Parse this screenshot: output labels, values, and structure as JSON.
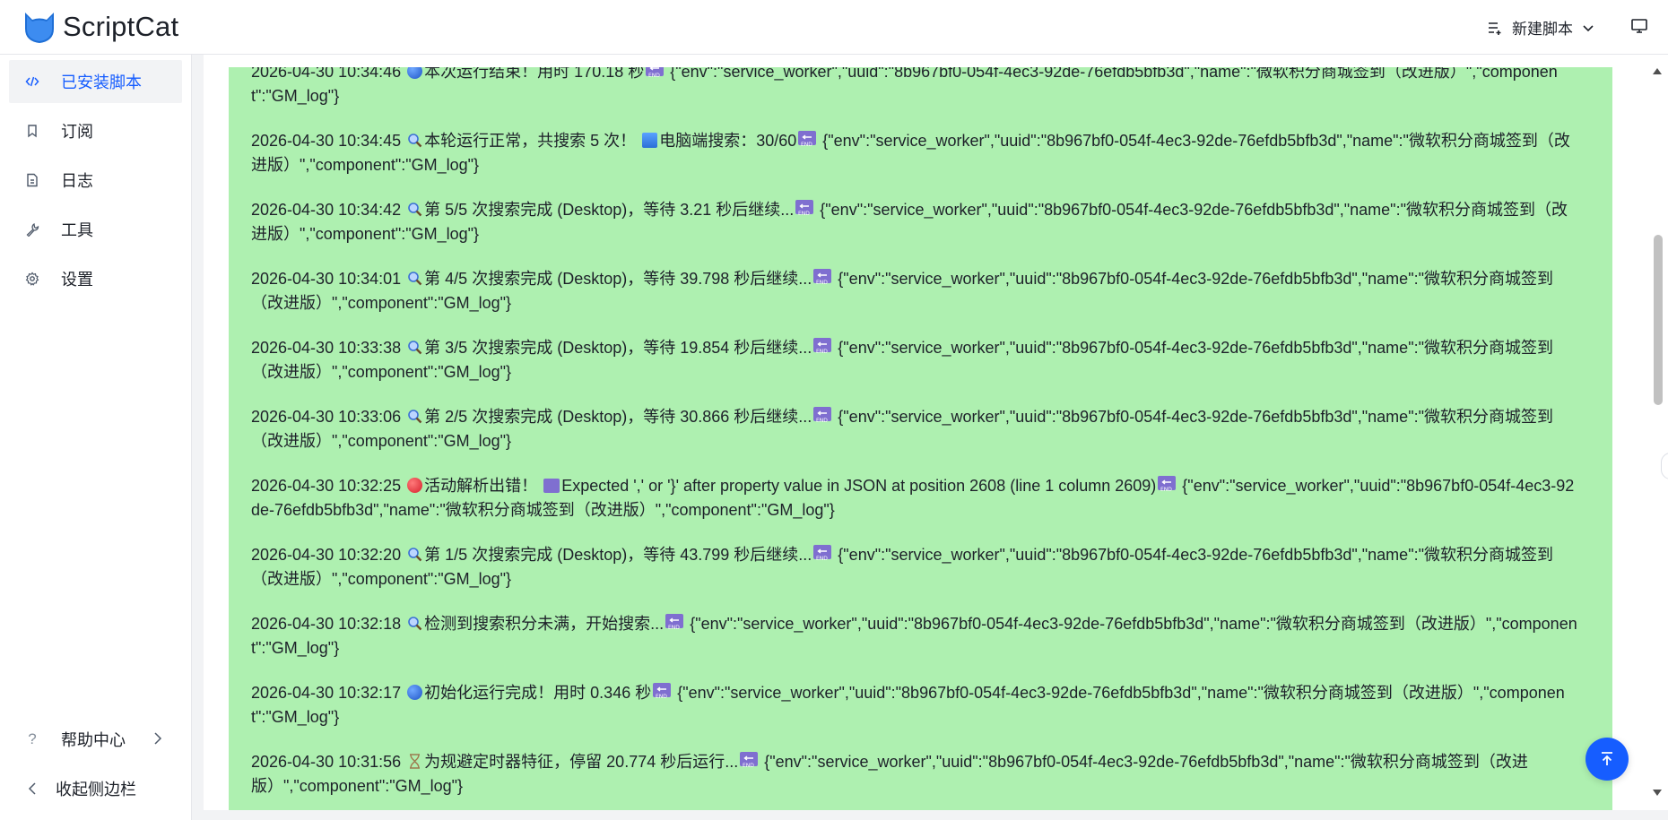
{
  "header": {
    "app_title": "ScriptCat",
    "new_script_label": "新建脚本"
  },
  "sidebar": {
    "items": [
      {
        "label": "已安装脚本",
        "active": true,
        "icon": "code-icon"
      },
      {
        "label": "订阅",
        "active": false,
        "icon": "bookmark-icon"
      },
      {
        "label": "日志",
        "active": false,
        "icon": "document-icon"
      },
      {
        "label": "工具",
        "active": false,
        "icon": "wrench-icon"
      },
      {
        "label": "设置",
        "active": false,
        "icon": "gear-icon"
      }
    ],
    "help_label": "帮助中心",
    "collapse_label": "收起侧边栏"
  },
  "logs": [
    {
      "time": "2026-04-30 10:34:46",
      "icon": "globe-icon",
      "message": "本次运行结束！用时 170.18 秒",
      "meta": " {\"env\":\"service_worker\",\"uuid\":\"8b967bf0-054f-4ec3-92de-76efdb5bfb3d\",\"name\":\"微软积分商城签到（改进版）\",\"component\":\"GM_log\"}"
    },
    {
      "time": "2026-04-30 10:34:45",
      "icon": "magnifier-icon",
      "message": "本轮运行正常，共搜索 5 次！",
      "extra_icon": "computer-icon",
      "extra": "电脑端搜索：30/60",
      "meta": " {\"env\":\"service_worker\",\"uuid\":\"8b967bf0-054f-4ec3-92de-76efdb5bfb3d\",\"name\":\"微软积分商城签到（改进版）\",\"component\":\"GM_log\"}"
    },
    {
      "time": "2026-04-30 10:34:42",
      "icon": "magnifier-icon",
      "message": "第 5/5 次搜索完成 (Desktop)，等待 3.21 秒后继续...",
      "meta": " {\"env\":\"service_worker\",\"uuid\":\"8b967bf0-054f-4ec3-92de-76efdb5bfb3d\",\"name\":\"微软积分商城签到（改进版）\",\"component\":\"GM_log\"}"
    },
    {
      "time": "2026-04-30 10:34:01",
      "icon": "magnifier-icon",
      "message": "第 4/5 次搜索完成 (Desktop)，等待 39.798 秒后继续...",
      "meta": " {\"env\":\"service_worker\",\"uuid\":\"8b967bf0-054f-4ec3-92de-76efdb5bfb3d\",\"name\":\"微软积分商城签到（改进版）\",\"component\":\"GM_log\"}"
    },
    {
      "time": "2026-04-30 10:33:38",
      "icon": "magnifier-icon",
      "message": "第 3/5 次搜索完成 (Desktop)，等待 19.854 秒后继续...",
      "meta": " {\"env\":\"service_worker\",\"uuid\":\"8b967bf0-054f-4ec3-92de-76efdb5bfb3d\",\"name\":\"微软积分商城签到（改进版）\",\"component\":\"GM_log\"}"
    },
    {
      "time": "2026-04-30 10:33:06",
      "icon": "magnifier-icon",
      "message": "第 2/5 次搜索完成 (Desktop)，等待 30.866 秒后继续...",
      "meta": " {\"env\":\"service_worker\",\"uuid\":\"8b967bf0-054f-4ec3-92de-76efdb5bfb3d\",\"name\":\"微软积分商城签到（改进版）\",\"component\":\"GM_log\"}"
    },
    {
      "time": "2026-04-30 10:32:25",
      "icon": "red-circle-icon",
      "message": "活动解析出错！",
      "extra_icon": "arrows-icon",
      "extra": "Expected ',' or '}' after property value in JSON at position 2608 (line 1 column 2609)",
      "meta": " {\"env\":\"service_worker\",\"uuid\":\"8b967bf0-054f-4ec3-92de-76efdb5bfb3d\",\"name\":\"微软积分商城签到（改进版）\",\"component\":\"GM_log\"}"
    },
    {
      "time": "2026-04-30 10:32:20",
      "icon": "magnifier-icon",
      "message": "第 1/5 次搜索完成 (Desktop)，等待 43.799 秒后继续...",
      "meta": " {\"env\":\"service_worker\",\"uuid\":\"8b967bf0-054f-4ec3-92de-76efdb5bfb3d\",\"name\":\"微软积分商城签到（改进版）\",\"component\":\"GM_log\"}"
    },
    {
      "time": "2026-04-30 10:32:18",
      "icon": "magnifier-icon",
      "message": "检测到搜索积分未满，开始搜索...",
      "meta": " {\"env\":\"service_worker\",\"uuid\":\"8b967bf0-054f-4ec3-92de-76efdb5bfb3d\",\"name\":\"微软积分商城签到（改进版）\",\"component\":\"GM_log\"}"
    },
    {
      "time": "2026-04-30 10:32:17",
      "icon": "globe-icon",
      "message": "初始化运行完成！用时 0.346 秒",
      "meta": " {\"env\":\"service_worker\",\"uuid\":\"8b967bf0-054f-4ec3-92de-76efdb5bfb3d\",\"name\":\"微软积分商城签到（改进版）\",\"component\":\"GM_log\"}"
    },
    {
      "time": "2026-04-30 10:31:56",
      "icon": "hourglass-icon",
      "message": "为规避定时器特征，停留 20.774 秒后运行...",
      "meta": " {\"env\":\"service_worker\",\"uuid\":\"8b967bf0-054f-4ec3-92de-76efdb5bfb3d\",\"name\":\"微软积分商城签到（改进版）\",\"component\":\"GM_log\"}"
    }
  ],
  "colors": {
    "accent": "#165dff",
    "log_background": "#aef0b0",
    "end_badge": "#7f6fd0"
  }
}
